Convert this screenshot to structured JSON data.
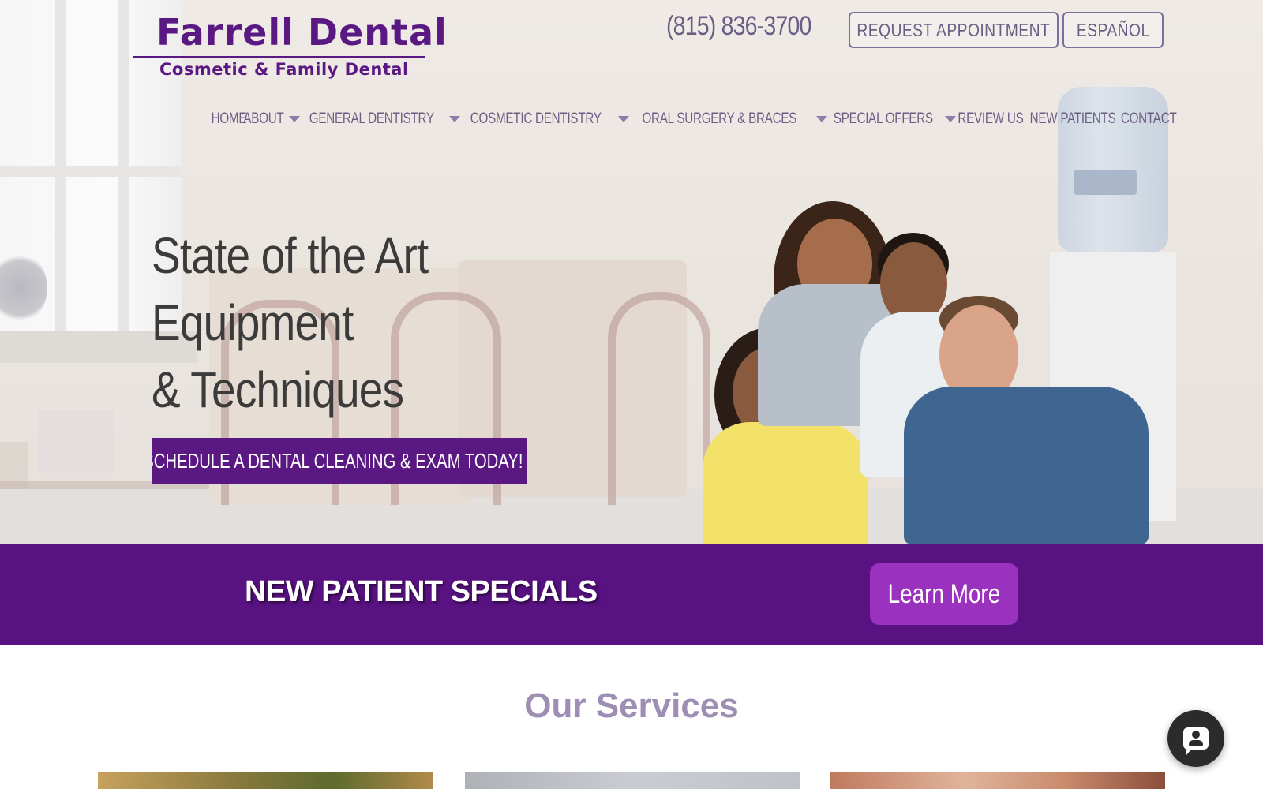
{
  "logo": {
    "title": "Farrell Dental",
    "subtitle": "Cosmetic & Family Dental",
    "brand_color": "#5a1883"
  },
  "header": {
    "phone": "(815) 836-3700",
    "request_appointment": "REQUEST APPOINTMENT",
    "espanol": "ESPAÑOL"
  },
  "nav": {
    "items": [
      {
        "label": "HOME",
        "has_dropdown": false
      },
      {
        "label": "ABOUT",
        "has_dropdown": true
      },
      {
        "label": "GENERAL DENTISTRY",
        "has_dropdown": true
      },
      {
        "label": "COSMETIC DENTISTRY",
        "has_dropdown": true
      },
      {
        "label": "ORAL SURGERY & BRACES",
        "has_dropdown": true
      },
      {
        "label": "SPECIAL OFFERS",
        "has_dropdown": true
      },
      {
        "label": "REVIEW US",
        "has_dropdown": false
      },
      {
        "label": "NEW PATIENTS",
        "has_dropdown": false
      },
      {
        "label": "CONTACT",
        "has_dropdown": false
      }
    ]
  },
  "hero": {
    "heading_lines": [
      "State of the Art",
      "Equipment",
      "& Techniques"
    ],
    "cta": "SCHEDULE A DENTAL CLEANING & EXAM TODAY! »"
  },
  "banner": {
    "title": "NEW PATIENT SPECIALS",
    "button": "Learn More",
    "background_color": "#581281",
    "button_color": "#9b31bf"
  },
  "services": {
    "title": "Our Services"
  },
  "chat": {
    "icon": "chat-icon"
  }
}
